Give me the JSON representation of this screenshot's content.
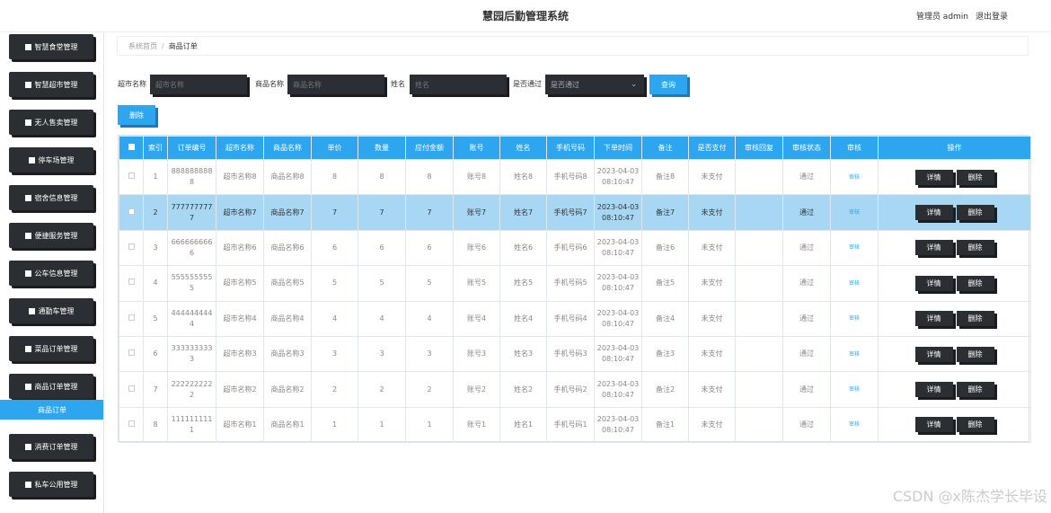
{
  "header": {
    "title": "慧园后勤管理系统",
    "user_label": "管理员 admin",
    "logout_label": "退出登录"
  },
  "sidebar": {
    "items": [
      {
        "label": "智慧食堂管理"
      },
      {
        "label": "智慧超市管理"
      },
      {
        "label": "无人售卖管理"
      },
      {
        "label": "停车场管理"
      },
      {
        "label": "宿舍信息管理"
      },
      {
        "label": "便捷服务管理"
      },
      {
        "label": "公车信息管理"
      },
      {
        "label": "通勤车管理"
      },
      {
        "label": "菜品订单管理"
      },
      {
        "label": "商品订单管理"
      },
      {
        "label": "消费订单管理"
      },
      {
        "label": "私车公用管理"
      }
    ],
    "active_sub": "商品订单"
  },
  "breadcrumb": {
    "home": "系统首页",
    "current": "商品订单"
  },
  "search": {
    "market_label": "超市名称",
    "market_placeholder": "超市名称",
    "product_label": "商品名称",
    "product_placeholder": "商品名称",
    "name_label": "姓名",
    "name_placeholder": "姓名",
    "approved_label": "是否通过",
    "approved_value": "是否通过",
    "query_label": "查询",
    "delete_label": "删除"
  },
  "table": {
    "headers": [
      "",
      "索引",
      "订单编号",
      "超市名称",
      "商品名称",
      "单价",
      "数量",
      "应付金额",
      "账号",
      "姓名",
      "手机号码",
      "下单时间",
      "备注",
      "是否支付",
      "审核回复",
      "审核状态",
      "审核",
      "操作"
    ],
    "rows": [
      {
        "idx": "1",
        "order": "8888888888",
        "market": "超市名称8",
        "product": "商品名称8",
        "price": "8",
        "qty": "8",
        "amount": "8",
        "account": "账号8",
        "name": "姓名8",
        "phone": "手机号码8",
        "time": "2023-04-03 08:10:47",
        "note": "备注8",
        "paid": "未支付",
        "reply": "",
        "status": "通过",
        "audit": "审核",
        "detail": "详情",
        "del": "删除"
      },
      {
        "idx": "2",
        "order": "7777777777",
        "market": "超市名称7",
        "product": "商品名称7",
        "price": "7",
        "qty": "7",
        "amount": "7",
        "account": "账号7",
        "name": "姓名7",
        "phone": "手机号码7",
        "time": "2023-04-03 08:10:47",
        "note": "备注7",
        "paid": "未支付",
        "reply": "",
        "status": "通过",
        "audit": "审核",
        "detail": "详情",
        "del": "删除"
      },
      {
        "idx": "3",
        "order": "6666666666",
        "market": "超市名称6",
        "product": "商品名称6",
        "price": "6",
        "qty": "6",
        "amount": "6",
        "account": "账号6",
        "name": "姓名6",
        "phone": "手机号码6",
        "time": "2023-04-03 08:10:47",
        "note": "备注6",
        "paid": "未支付",
        "reply": "",
        "status": "通过",
        "audit": "审核",
        "detail": "详情",
        "del": "删除"
      },
      {
        "idx": "4",
        "order": "5555555555",
        "market": "超市名称5",
        "product": "商品名称5",
        "price": "5",
        "qty": "5",
        "amount": "5",
        "account": "账号5",
        "name": "姓名5",
        "phone": "手机号码5",
        "time": "2023-04-03 08:10:47",
        "note": "备注5",
        "paid": "未支付",
        "reply": "",
        "status": "通过",
        "audit": "审核",
        "detail": "详情",
        "del": "删除"
      },
      {
        "idx": "5",
        "order": "4444444444",
        "market": "超市名称4",
        "product": "商品名称4",
        "price": "4",
        "qty": "4",
        "amount": "4",
        "account": "账号4",
        "name": "姓名4",
        "phone": "手机号码4",
        "time": "2023-04-03 08:10:47",
        "note": "备注4",
        "paid": "未支付",
        "reply": "",
        "status": "通过",
        "audit": "审核",
        "detail": "详情",
        "del": "删除"
      },
      {
        "idx": "6",
        "order": "3333333333",
        "market": "超市名称3",
        "product": "商品名称3",
        "price": "3",
        "qty": "3",
        "amount": "3",
        "account": "账号3",
        "name": "姓名3",
        "phone": "手机号码3",
        "time": "2023-04-03 08:10:47",
        "note": "备注3",
        "paid": "未支付",
        "reply": "",
        "status": "通过",
        "audit": "审核",
        "detail": "详情",
        "del": "删除"
      },
      {
        "idx": "7",
        "order": "2222222222",
        "market": "超市名称2",
        "product": "商品名称2",
        "price": "2",
        "qty": "2",
        "amount": "2",
        "account": "账号2",
        "name": "姓名2",
        "phone": "手机号码2",
        "time": "2023-04-03 08:10:47",
        "note": "备注2",
        "paid": "未支付",
        "reply": "",
        "status": "通过",
        "audit": "审核",
        "detail": "详情",
        "del": "删除"
      },
      {
        "idx": "8",
        "order": "1111111111",
        "market": "超市名称1",
        "product": "商品名称1",
        "price": "1",
        "qty": "1",
        "amount": "1",
        "account": "账号1",
        "name": "姓名1",
        "phone": "手机号码1",
        "time": "2023-04-03 08:10:47",
        "note": "备注1",
        "paid": "未支付",
        "reply": "",
        "status": "通过",
        "audit": "审核",
        "detail": "详情",
        "del": "删除"
      }
    ]
  },
  "watermark": "CSDN @x陈杰学长毕设",
  "colors": {
    "accent": "#2ea6ef",
    "dark": "#2b2f33",
    "selected_row": "#a8d7f3"
  }
}
